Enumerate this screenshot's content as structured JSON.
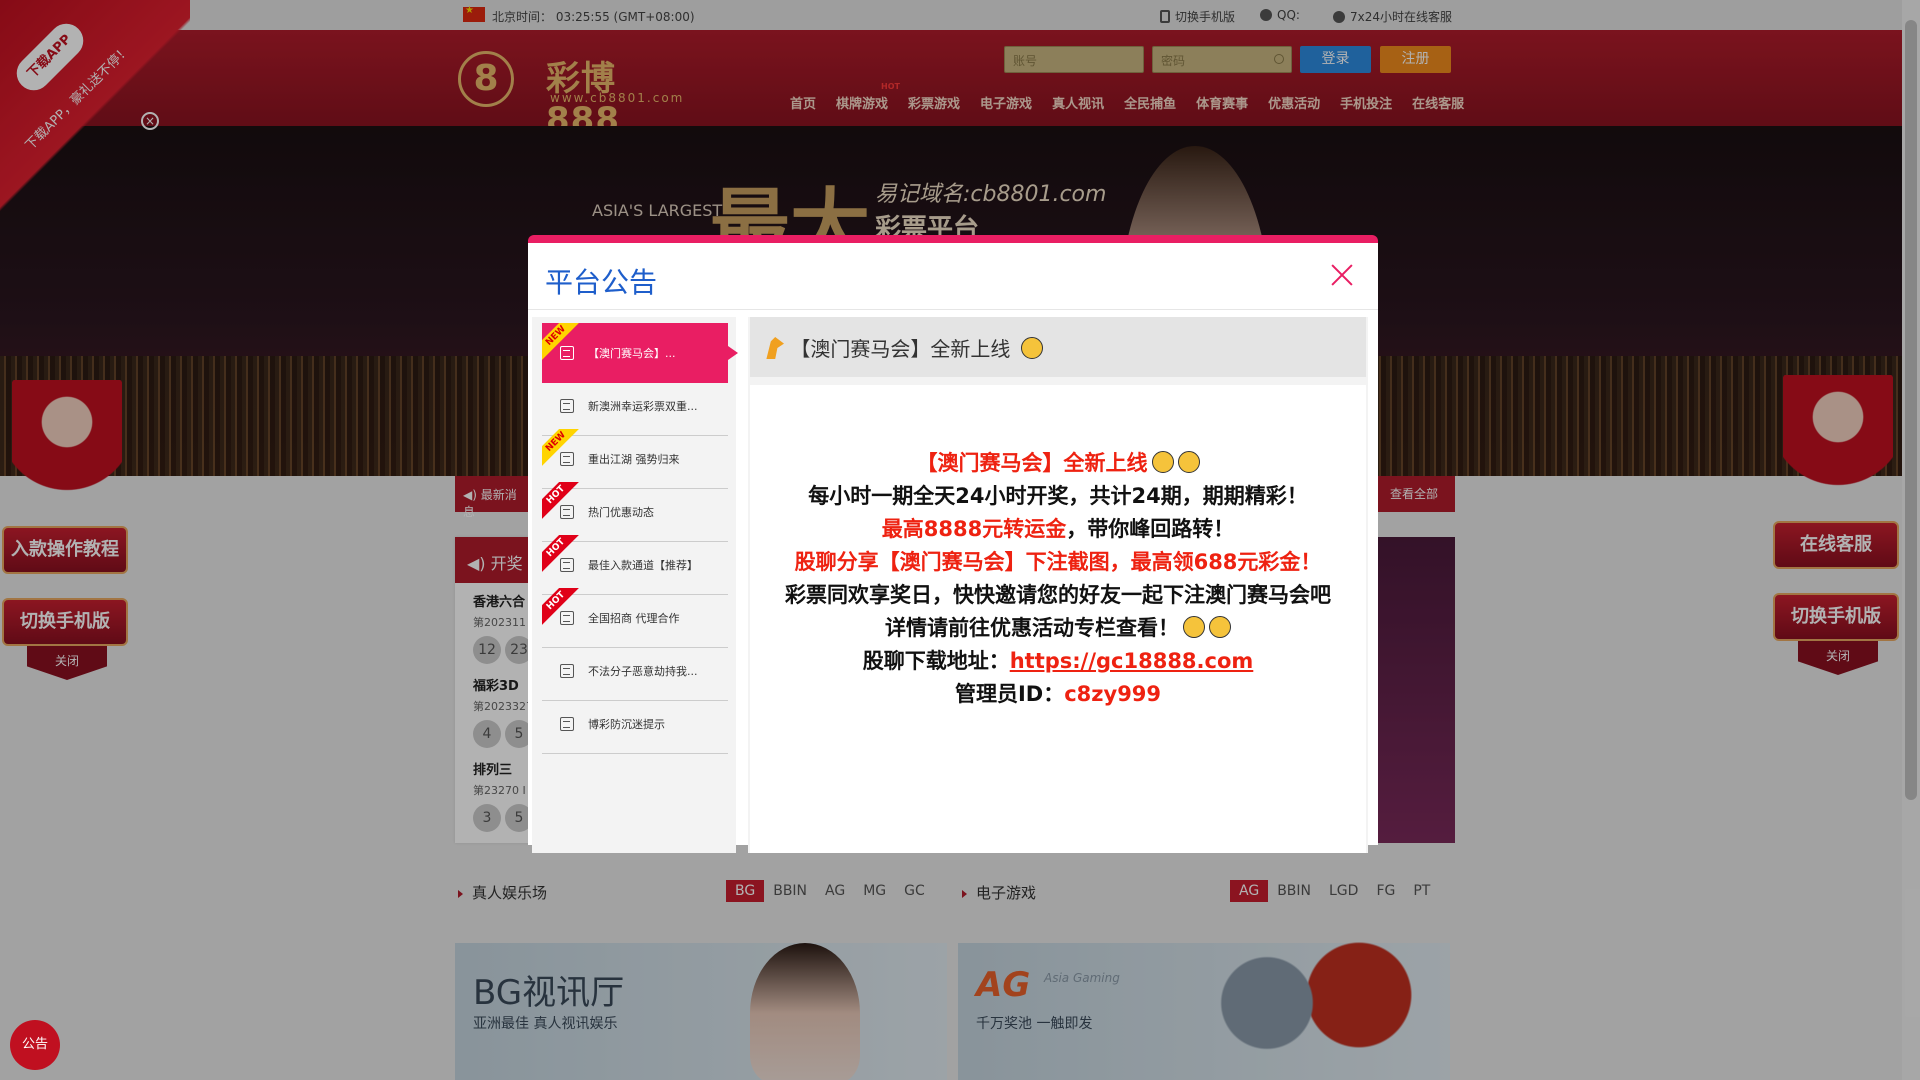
{
  "topbar": {
    "time_label": "北京时间：",
    "time_value": "03:25:55 (GMT+08:00)",
    "mobile_link": "切换手机版",
    "qq_label": "QQ:",
    "support_link": "7x24小时在线客服"
  },
  "header": {
    "logo_mark": "8",
    "logo_name": "彩博888",
    "logo_url": "www.cb8801.com",
    "username_placeholder": "账号",
    "password_placeholder": "密码",
    "login_label": "登录",
    "register_label": "注册",
    "nav": [
      "首页",
      "棋牌游戏",
      "彩票游戏",
      "电子游戏",
      "真人视讯",
      "全民捕鱼",
      "体育赛事",
      "优惠活动",
      "手机投注",
      "在线客服"
    ]
  },
  "banner": {
    "tagline_en": "ASIA'S LARGEST",
    "big_text": "最大",
    "domain_text": "易记域名:cb8801.com",
    "sub_text": "彩票平台"
  },
  "newsbar": {
    "label": "最新消息",
    "view_all": "查看全部"
  },
  "lottery": {
    "title": "开奖",
    "items": [
      {
        "name": "香港六合",
        "period": "第202311",
        "balls": [
          "12",
          "23"
        ]
      },
      {
        "name": "福彩3D",
        "period": "第2023327",
        "balls": [
          "4",
          "5"
        ]
      },
      {
        "name": "排列三",
        "period": "第23270 I",
        "balls": [
          "3",
          "5"
        ]
      }
    ]
  },
  "sections": {
    "live": {
      "title": "真人娱乐场",
      "tabs": [
        "BG",
        "BBIN",
        "AG",
        "MG",
        "GC"
      ],
      "active": "BG",
      "card_title": "BG视讯厅",
      "card_sub": "亚洲最佳 真人视讯娱乐"
    },
    "slots": {
      "title": "电子游戏",
      "tabs": [
        "AG",
        "BBIN",
        "LGD",
        "FG",
        "PT"
      ],
      "active": "AG",
      "card_logo": "AG",
      "card_logo_sub": "Asia Gaming",
      "card_sub": "千万奖池 一触即发"
    }
  },
  "floaters": {
    "ribbon_pill": "下载APP",
    "ribbon_text": "下载APP，豪礼送不停！",
    "left_buttons": [
      "入款操作教程",
      "切换手机版"
    ],
    "right_buttons": [
      "在线客服",
      "切换手机版"
    ],
    "close_label": "关闭",
    "announcement_btn": "公告"
  },
  "modal": {
    "title": "平台公告",
    "items": [
      {
        "label": "【澳门赛马会】...",
        "badge": "NEW",
        "active": true
      },
      {
        "label": "新澳洲幸运彩票双重...",
        "badge": "",
        "active": false
      },
      {
        "label": "重出江湖 强势归来",
        "badge": "NEW",
        "active": false
      },
      {
        "label": "热门优惠动态",
        "badge": "HOT",
        "active": false
      },
      {
        "label": "最佳入款通道【推荐】",
        "badge": "HOT",
        "active": false
      },
      {
        "label": "全国招商 代理合作",
        "badge": "HOT",
        "active": false
      },
      {
        "label": "不法分子恶意劫持我...",
        "badge": "",
        "active": false
      },
      {
        "label": "博彩防沉迷提示",
        "badge": "",
        "active": false
      }
    ],
    "detail_title": "【澳门赛马会】全新上线",
    "lines": [
      {
        "text": "【澳门赛马会】全新上线",
        "color": "red"
      },
      {
        "text": "每小时一期全天24小时开奖，共计24期，期期精彩！",
        "color": "black"
      },
      {
        "text_red": "最高8888元转运金",
        "text_black": "，带你峰回路转！"
      },
      {
        "text": "股聊分享【澳门赛马会】下注截图，最高领688元彩金！",
        "color": "red"
      },
      {
        "text": "彩票同欢享奖日，快快邀请您的好友一起下注澳门赛马会吧",
        "color": "black"
      },
      {
        "text": "详情请前往优惠活动专栏查看！",
        "color": "black"
      },
      {
        "label": "股聊下载地址：",
        "value": "https://gc18888.com"
      },
      {
        "label": "管理员ID：",
        "value": "c8zy999"
      }
    ]
  },
  "colors": {
    "brand_red": "#b01c2b",
    "modal_accent": "#e91e63",
    "title_blue": "#1e5ecb",
    "text_red": "#ee2211"
  }
}
